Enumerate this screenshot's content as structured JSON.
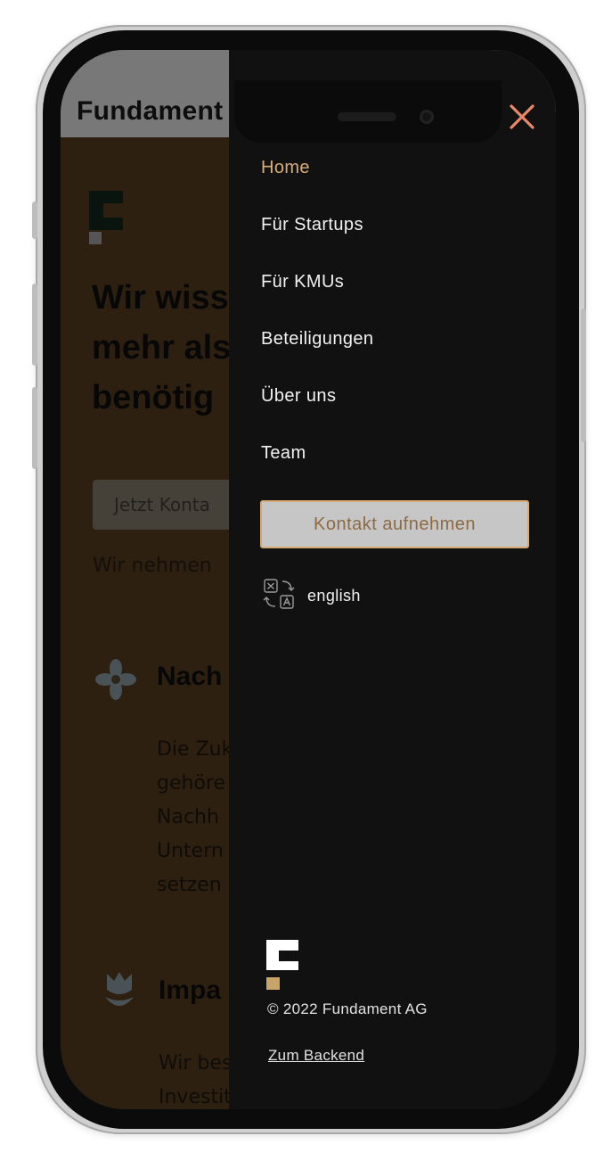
{
  "background_page": {
    "logo_text": "Fundament",
    "heading": "Wir wiss\nmehr als\nbenötig",
    "cta_label": "Jetzt Konta",
    "subtext": "Wir nehmen",
    "feature1": {
      "icon": "flower-icon",
      "title": "Nach",
      "text": "Die Zuk\ngehöre\nNachh\nUntern\nsetzen"
    },
    "feature2": {
      "icon": "tulip-icon",
      "title": "Impa",
      "text": "Wir bes\nInvestit"
    }
  },
  "menu": {
    "close_icon": "close-icon",
    "accent_color": "#d9ad78",
    "close_color": "#e8896a",
    "items": [
      {
        "label": "Home",
        "active": true
      },
      {
        "label": "Für Startups",
        "active": false
      },
      {
        "label": "Für KMUs",
        "active": false
      },
      {
        "label": "Beteiligungen",
        "active": false
      },
      {
        "label": "Über uns",
        "active": false
      },
      {
        "label": "Team",
        "active": false
      }
    ],
    "contact_button": "Kontakt aufnehmen",
    "language": {
      "icon": "translate-icon",
      "label": "english"
    },
    "copyright": "© 2022 Fundament AG",
    "backend_link": "Zum Backend"
  }
}
